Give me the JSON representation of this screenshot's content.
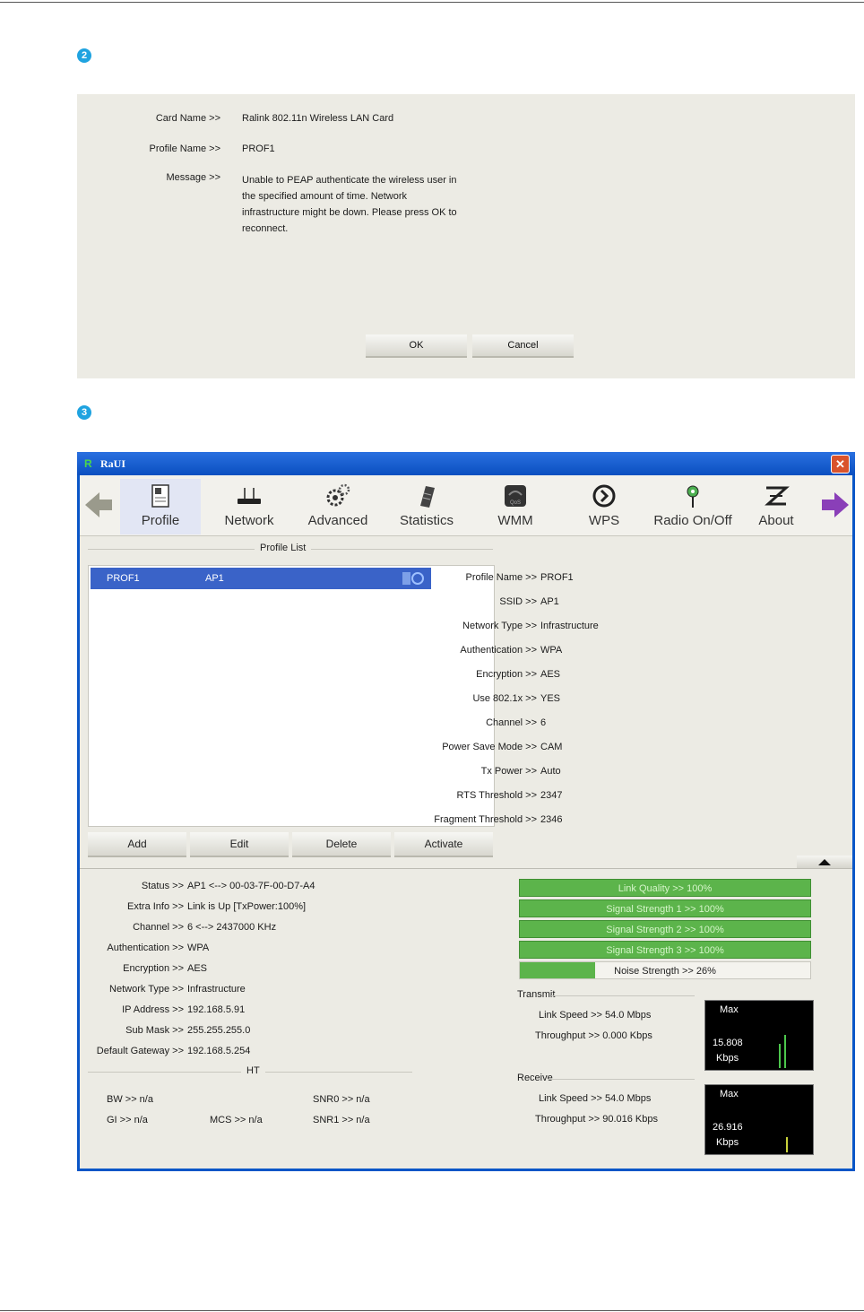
{
  "steps": [
    "2",
    "3"
  ],
  "dialog": {
    "card_label": "Card Name >>",
    "card_value": "Ralink 802.11n Wireless LAN Card",
    "profile_label": "Profile Name >>",
    "profile_value": "PROF1",
    "message_label": "Message >>",
    "message_value": "Unable to PEAP authenticate the wireless user in the specified amount of time. Network infrastructure might be down. Please press OK to reconnect.",
    "ok": "OK",
    "cancel": "Cancel"
  },
  "window": {
    "title": "RaUI",
    "toolbar": [
      "Profile",
      "Network",
      "Advanced",
      "Statistics",
      "WMM",
      "WPS",
      "Radio On/Off",
      "About"
    ],
    "profile_list_title": "Profile List",
    "list_row": {
      "name": "PROF1",
      "ssid": "AP1"
    },
    "buttons": [
      "Add",
      "Edit",
      "Delete",
      "Activate"
    ],
    "details": [
      {
        "label": "Profile Name >>",
        "value": "PROF1"
      },
      {
        "label": "SSID >>",
        "value": "AP1"
      },
      {
        "label": "Network Type >>",
        "value": "Infrastructure"
      },
      {
        "label": "Authentication >>",
        "value": "WPA"
      },
      {
        "label": "Encryption >>",
        "value": "AES"
      },
      {
        "label": "Use 802.1x >>",
        "value": "YES"
      },
      {
        "label": "Channel >>",
        "value": "6"
      },
      {
        "label": "Power Save Mode >>",
        "value": "CAM"
      },
      {
        "label": "Tx Power >>",
        "value": "Auto"
      },
      {
        "label": "RTS Threshold >>",
        "value": "2347"
      },
      {
        "label": "Fragment Threshold >>",
        "value": "2346"
      }
    ],
    "status": [
      {
        "label": "Status >>",
        "value": "AP1 <--> 00-03-7F-00-D7-A4"
      },
      {
        "label": "Extra Info >>",
        "value": "Link is Up [TxPower:100%]"
      },
      {
        "label": "Channel >>",
        "value": "6 <--> 2437000 KHz"
      },
      {
        "label": "Authentication >>",
        "value": "WPA"
      },
      {
        "label": "Encryption >>",
        "value": "AES"
      },
      {
        "label": "Network Type >>",
        "value": "Infrastructure"
      },
      {
        "label": "IP Address >>",
        "value": "192.168.5.91"
      },
      {
        "label": "Sub Mask >>",
        "value": "255.255.255.0"
      },
      {
        "label": "Default Gateway >>",
        "value": "192.168.5.254"
      }
    ],
    "ht_title": "HT",
    "ht": {
      "bw": "BW >> n/a",
      "gi": "GI >> n/a",
      "mcs": "MCS >> n/a",
      "snr0": "SNR0 >> n/a",
      "snr1": "SNR1 >> n/a"
    },
    "quality": [
      {
        "text": "Link Quality >> 100%",
        "level": 1.0
      },
      {
        "text": "Signal Strength 1 >> 100%",
        "level": 1.0
      },
      {
        "text": "Signal Strength 2 >> 100%",
        "level": 1.0
      },
      {
        "text": "Signal Strength 3 >> 100%",
        "level": 1.0
      },
      {
        "text": "Noise Strength >> 26%",
        "level": 0.26
      }
    ],
    "transmit": {
      "title": "Transmit",
      "link_speed": "Link Speed >> 54.0 Mbps",
      "throughput": "Throughput >> 0.000 Kbps",
      "graph_max": "Max",
      "graph_value": "15.808",
      "graph_unit": "Kbps"
    },
    "receive": {
      "title": "Receive",
      "link_speed": "Link Speed >> 54.0 Mbps",
      "throughput": "Throughput >> 90.016 Kbps",
      "graph_max": "Max",
      "graph_value": "26.916",
      "graph_unit": "Kbps"
    },
    "colors": {
      "bar": "#5cb44b",
      "selected_row": "#3a63c8",
      "titlebar": "#0a56c7"
    }
  }
}
